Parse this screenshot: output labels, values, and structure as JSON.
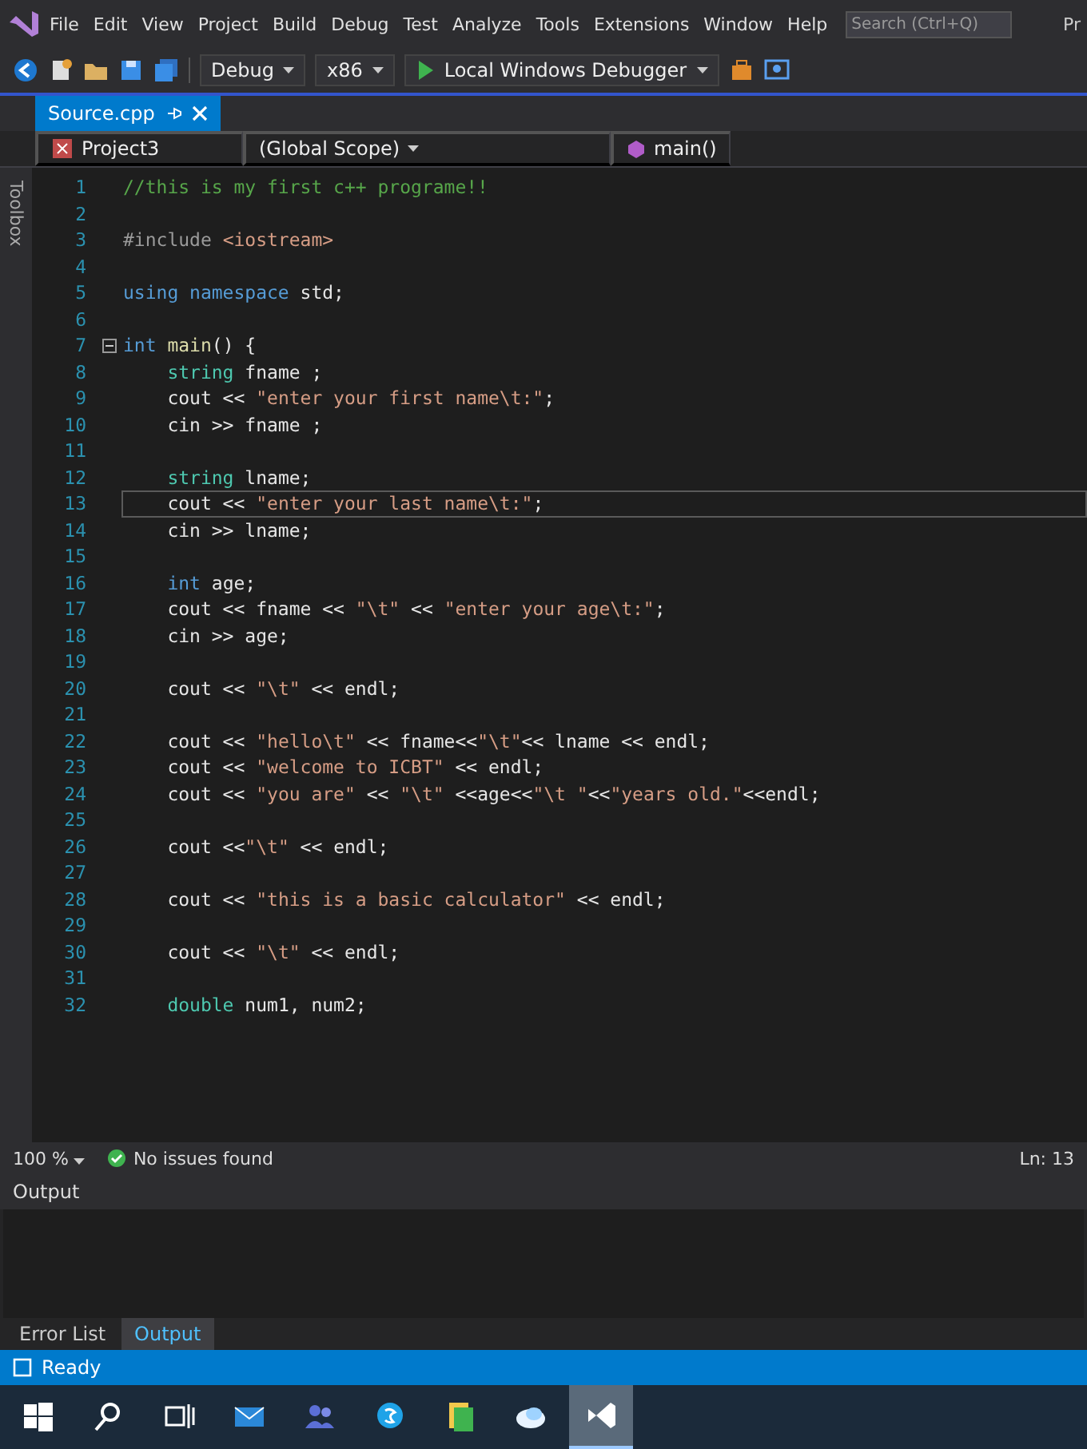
{
  "menu": {
    "items": [
      "File",
      "Edit",
      "View",
      "Project",
      "Build",
      "Debug",
      "Test",
      "Analyze",
      "Tools",
      "Extensions",
      "Window",
      "Help"
    ],
    "search": {
      "placeholder": "Search (Ctrl+Q)"
    },
    "title": "Pr"
  },
  "toolbar": {
    "configuration": "Debug",
    "platform": "x86",
    "run_label": "Local Windows Debugger"
  },
  "tabs": [
    {
      "label": "Source.cpp",
      "selected": true
    }
  ],
  "navbar": {
    "project": "Project3",
    "scope": "(Global Scope)",
    "member": "main()"
  },
  "side_tab": "Toolbox",
  "editor": {
    "lines": [
      {
        "number": "1",
        "current": false,
        "tokens": [
          {
            "kind": "comment",
            "text": "//this is my first c++ programe!!"
          }
        ]
      },
      {
        "number": "2",
        "current": false
      },
      {
        "number": "3",
        "current": false,
        "tokens": [
          {
            "kind": "preproc",
            "text": "#include "
          },
          {
            "kind": "string",
            "text": "<iostream>"
          }
        ]
      },
      {
        "number": "4",
        "current": false
      },
      {
        "number": "5",
        "current": false,
        "tokens": [
          {
            "kind": "keyword",
            "text": "using namespace"
          },
          {
            "kind": "plain",
            "text": " std;"
          }
        ]
      },
      {
        "number": "6",
        "current": false
      },
      {
        "number": "7",
        "current": false,
        "fold": true,
        "tokens": [
          {
            "kind": "keyword",
            "text": "int"
          },
          {
            "kind": "function",
            "text": " main"
          },
          {
            "kind": "plain",
            "text": "() {"
          }
        ]
      },
      {
        "number": "8",
        "current": false,
        "tokens": [
          {
            "kind": "type",
            "text": "    string"
          },
          {
            "kind": "plain",
            "text": " fname ;"
          }
        ]
      },
      {
        "number": "9",
        "current": false,
        "tokens": [
          {
            "kind": "plain",
            "text": "    cout << "
          },
          {
            "kind": "string",
            "text": "\"enter your first name\\t:\""
          },
          {
            "kind": "plain",
            "text": ";"
          }
        ]
      },
      {
        "number": "10",
        "current": false,
        "tokens": [
          {
            "kind": "plain",
            "text": "    cin >> fname ;"
          }
        ]
      },
      {
        "number": "11",
        "current": false
      },
      {
        "number": "12",
        "current": false,
        "tokens": [
          {
            "kind": "type",
            "text": "    string"
          },
          {
            "kind": "plain",
            "text": " lname;"
          }
        ]
      },
      {
        "number": "13",
        "current": true,
        "tokens": [
          {
            "kind": "plain",
            "text": "    cout << "
          },
          {
            "kind": "string",
            "text": "\"enter your last name\\t:\""
          },
          {
            "kind": "plain",
            "text": ";"
          }
        ]
      },
      {
        "number": "14",
        "current": false,
        "tokens": [
          {
            "kind": "plain",
            "text": "    cin >> lname;"
          }
        ]
      },
      {
        "number": "15",
        "current": false
      },
      {
        "number": "16",
        "current": false,
        "tokens": [
          {
            "kind": "keyword",
            "text": "    int"
          },
          {
            "kind": "plain",
            "text": " age;"
          }
        ]
      },
      {
        "number": "17",
        "current": false,
        "tokens": [
          {
            "kind": "plain",
            "text": "    cout << fname << "
          },
          {
            "kind": "string",
            "text": "\"\\t\""
          },
          {
            "kind": "plain",
            "text": " << "
          },
          {
            "kind": "string",
            "text": "\"enter your age\\t:\""
          },
          {
            "kind": "plain",
            "text": ";"
          }
        ]
      },
      {
        "number": "18",
        "current": false,
        "tokens": [
          {
            "kind": "plain",
            "text": "    cin >> age;"
          }
        ]
      },
      {
        "number": "19",
        "current": false
      },
      {
        "number": "20",
        "current": false,
        "tokens": [
          {
            "kind": "plain",
            "text": "    cout << "
          },
          {
            "kind": "string",
            "text": "\"\\t\""
          },
          {
            "kind": "plain",
            "text": " << endl;"
          }
        ]
      },
      {
        "number": "21",
        "current": false
      },
      {
        "number": "22",
        "current": false,
        "tokens": [
          {
            "kind": "plain",
            "text": "    cout << "
          },
          {
            "kind": "string",
            "text": "\"hello\\t\""
          },
          {
            "kind": "plain",
            "text": " << fname<<"
          },
          {
            "kind": "string",
            "text": "\"\\t\""
          },
          {
            "kind": "plain",
            "text": "<< lname << endl;"
          }
        ]
      },
      {
        "number": "23",
        "current": false,
        "tokens": [
          {
            "kind": "plain",
            "text": "    cout << "
          },
          {
            "kind": "string",
            "text": "\"welcome to ICBT\""
          },
          {
            "kind": "plain",
            "text": " << endl;"
          }
        ]
      },
      {
        "number": "24",
        "current": false,
        "tokens": [
          {
            "kind": "plain",
            "text": "    cout << "
          },
          {
            "kind": "string",
            "text": "\"you are\""
          },
          {
            "kind": "plain",
            "text": " << "
          },
          {
            "kind": "string",
            "text": "\"\\t\""
          },
          {
            "kind": "plain",
            "text": " <<age<<"
          },
          {
            "kind": "string",
            "text": "\"\\t \""
          },
          {
            "kind": "plain",
            "text": "<<"
          },
          {
            "kind": "string",
            "text": "\"years old.\""
          },
          {
            "kind": "plain",
            "text": "<<endl;"
          }
        ]
      },
      {
        "number": "25",
        "current": false
      },
      {
        "number": "26",
        "current": false,
        "tokens": [
          {
            "kind": "plain",
            "text": "    cout <<"
          },
          {
            "kind": "string",
            "text": "\"\\t\""
          },
          {
            "kind": "plain",
            "text": " << endl;"
          }
        ]
      },
      {
        "number": "27",
        "current": false
      },
      {
        "number": "28",
        "current": false,
        "tokens": [
          {
            "kind": "plain",
            "text": "    cout << "
          },
          {
            "kind": "string",
            "text": "\"this is a basic calculator\""
          },
          {
            "kind": "plain",
            "text": " << endl;"
          }
        ]
      },
      {
        "number": "29",
        "current": false
      },
      {
        "number": "30",
        "current": false,
        "tokens": [
          {
            "kind": "plain",
            "text": "    cout << "
          },
          {
            "kind": "string",
            "text": "\"\\t\""
          },
          {
            "kind": "plain",
            "text": " << endl;"
          }
        ]
      },
      {
        "number": "31",
        "current": false
      },
      {
        "number": "32",
        "current": false,
        "tokens": [
          {
            "kind": "type",
            "text": "    double"
          },
          {
            "kind": "plain",
            "text": " num1, num2;"
          }
        ]
      }
    ]
  },
  "editor_status": {
    "zoom": "100 %",
    "issues": "No issues found",
    "position": "Ln: 13"
  },
  "output_panel": {
    "title": "Output"
  },
  "bottom_tabs": [
    {
      "label": "Error List",
      "selected": false
    },
    {
      "label": "Output",
      "selected": true
    }
  ],
  "status_bar": {
    "text": "Ready"
  },
  "taskbar": [
    {
      "kind": "start",
      "selected": false
    },
    {
      "kind": "search",
      "selected": false
    },
    {
      "kind": "taskview",
      "selected": false
    },
    {
      "kind": "mail",
      "selected": false
    },
    {
      "kind": "people",
      "selected": false
    },
    {
      "kind": "chat",
      "selected": false
    },
    {
      "kind": "files",
      "selected": false
    },
    {
      "kind": "cloud",
      "selected": false
    },
    {
      "kind": "editor",
      "selected": true
    }
  ]
}
